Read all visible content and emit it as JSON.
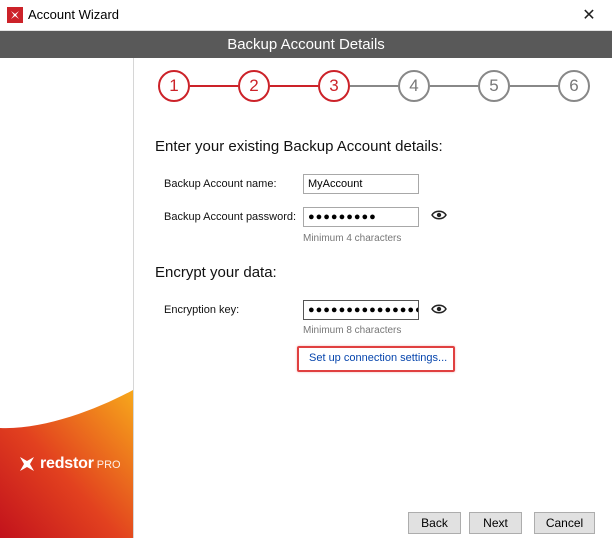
{
  "window": {
    "title": "Account Wizard",
    "close_symbol": "✕",
    "app_icon": "redstor-logo-icon"
  },
  "header": {
    "title": "Backup Account Details"
  },
  "steps": {
    "labels": [
      "1",
      "2",
      "3",
      "4",
      "5",
      "6"
    ],
    "completed_through": 3,
    "active_color": "#cc2229",
    "inactive_color": "#888888"
  },
  "account_section": {
    "heading": "Enter your existing Backup Account details:",
    "name_label": "Backup Account name:",
    "name_value": "MyAccount",
    "password_label": "Backup Account password:",
    "password_value": "●●●●●●●●●",
    "password_hint": "Minimum 4 characters",
    "show_password_icon": "eye-icon"
  },
  "encrypt_section": {
    "heading": "Encrypt your data:",
    "key_label": "Encryption key:",
    "key_value": "●●●●●●●●●●●●●●●●",
    "key_hint": "Minimum 8 characters",
    "show_key_icon": "eye-icon"
  },
  "connection_link": "Set up connection settings...",
  "brand": {
    "name": "redstor",
    "suffix": "PRO"
  },
  "buttons": {
    "back": "Back",
    "next": "Next",
    "cancel": "Cancel"
  },
  "colors": {
    "header_bg": "#595959",
    "brand_red": "#cc2229",
    "highlight": "#e04040",
    "link": "#0645ad"
  }
}
